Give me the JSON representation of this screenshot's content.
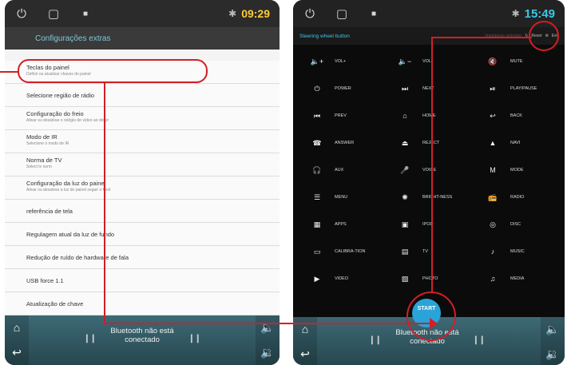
{
  "left_device": {
    "statusbar": {
      "time": "09:29",
      "icons": [
        "power-icon",
        "recent-apps-icon",
        "gallery-icon",
        "bluetooth-icon"
      ]
    },
    "header": {
      "title": "Configurações extras"
    },
    "settings": [
      {
        "title": "Teclas do painel",
        "subtitle": "Definir ou atualizar chaves do painel"
      },
      {
        "title": "Selecione região de rádio",
        "subtitle": ""
      },
      {
        "title": "Configuração do freio",
        "subtitle": "Ativar ou desativar o relógio de vídeo ao dirigir"
      },
      {
        "title": "Modo de IR",
        "subtitle": "Selecione o modo de IR"
      },
      {
        "title": "Norma de TV",
        "subtitle": "Select tv norm"
      },
      {
        "title": "Configuração da luz do painel",
        "subtitle": "Ativar ou desativar a luz do painel seguir o farol"
      },
      {
        "title": "referência de tela",
        "subtitle": ""
      },
      {
        "title": "Regulagem atual da luz de fundo",
        "subtitle": ""
      },
      {
        "title": "Redução de ruído de hardware de fala",
        "subtitle": ""
      },
      {
        "title": "USB force 1.1",
        "subtitle": ""
      },
      {
        "title": "Atualização de chave",
        "subtitle": ""
      }
    ],
    "bottom": {
      "bt_line1": "Bluetooth não está",
      "bt_line2": "conectado"
    }
  },
  "right_device": {
    "statusbar": {
      "time": "15:49"
    },
    "header": {
      "title": "Steering wheel button",
      "impedance": "Impedance selection",
      "reset": "Reset",
      "exit": "Exit"
    },
    "buttons": [
      {
        "icon": "🔈+",
        "label": "VOL+"
      },
      {
        "icon": "🔈−",
        "label": "VOL-"
      },
      {
        "icon": "🔇",
        "label": "MUTE"
      },
      {
        "icon": "⏻",
        "label": "POWER"
      },
      {
        "icon": "⏭",
        "label": "NEXT"
      },
      {
        "icon": "⏯",
        "label": "PLAY/PAUSE"
      },
      {
        "icon": "⏮",
        "label": "PREV"
      },
      {
        "icon": "⌂",
        "label": "HOME"
      },
      {
        "icon": "↩",
        "label": "BACK"
      },
      {
        "icon": "☎",
        "label": "ANSWER"
      },
      {
        "icon": "⏏",
        "label": "REJECT"
      },
      {
        "icon": "▲",
        "label": "NAVI"
      },
      {
        "icon": "🎧",
        "label": "AUX"
      },
      {
        "icon": "🎤",
        "label": "VOICE"
      },
      {
        "icon": "M",
        "label": "MODE"
      },
      {
        "icon": "☰",
        "label": "MENU"
      },
      {
        "icon": "✺",
        "label": "BRIGHT-NESS"
      },
      {
        "icon": "📻",
        "label": "RADIO"
      },
      {
        "icon": "▦",
        "label": "APPS"
      },
      {
        "icon": "▣",
        "label": "IPOD"
      },
      {
        "icon": "◎",
        "label": "DISC"
      },
      {
        "icon": "▭",
        "label": "CALIBRA-TION"
      },
      {
        "icon": "▤",
        "label": "TV"
      },
      {
        "icon": "♪",
        "label": "MUSIC"
      },
      {
        "icon": "▶",
        "label": "VIDEO"
      },
      {
        "icon": "▨",
        "label": "PHOTO"
      },
      {
        "icon": "♫",
        "label": "MEDIA"
      }
    ],
    "start_label": "START",
    "bottom": {
      "bt_line1": "Bluetooth não está",
      "bt_line2": "conectado"
    }
  },
  "colors": {
    "annotation": "#d21f26",
    "accent_teal": "#3cc7e6",
    "clock_orange": "#ffcc33",
    "start_blue": "#2aa3d8"
  }
}
